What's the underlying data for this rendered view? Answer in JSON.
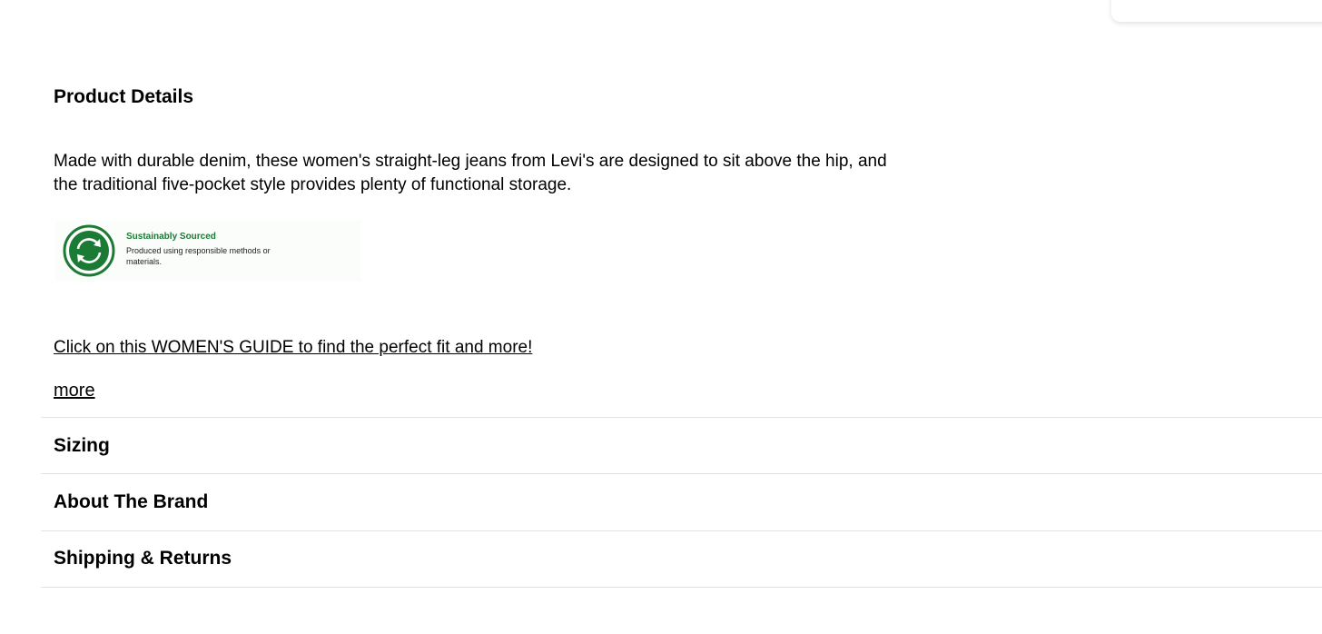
{
  "product_details": {
    "title": "Product Details",
    "description": "Made with durable denim, these women's straight-leg jeans from Levi's are designed to sit above the hip, and the traditional five-pocket style provides plenty of functional storage.",
    "badge": {
      "icon": "recycle-arrows-icon",
      "title": "Sustainably Sourced",
      "description": "Produced using responsible methods or materials.",
      "color": "#1b7a34"
    },
    "guide_link": "Click on this WOMEN'S GUIDE to find the perfect fit and more!",
    "more_link": "more"
  },
  "accordion": {
    "sizing": "Sizing",
    "about_brand": "About The Brand",
    "shipping_returns": "Shipping & Returns"
  }
}
